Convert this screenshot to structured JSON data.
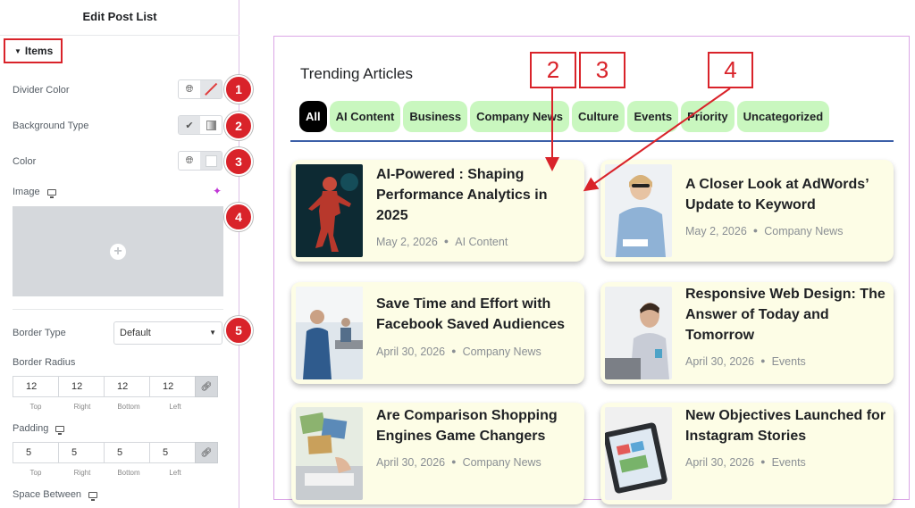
{
  "panel": {
    "title": "Edit Post List",
    "section": "Items",
    "divider_color_label": "Divider Color",
    "background_type_label": "Background Type",
    "color_label": "Color",
    "image_label": "Image",
    "border_type_label": "Border Type",
    "border_type_value": "Default",
    "border_radius_label": "Border Radius",
    "border_radius": [
      "12",
      "12",
      "12",
      "12"
    ],
    "padding_label": "Padding",
    "padding": [
      "5",
      "5",
      "5",
      "5"
    ],
    "dim_labels": [
      "Top",
      "Right",
      "Bottom",
      "Left"
    ],
    "space_between_label": "Space Between"
  },
  "badges": [
    "1",
    "2",
    "3",
    "4",
    "5"
  ],
  "annotations": [
    "2",
    "3",
    "4"
  ],
  "preview": {
    "heading": "Trending Articles",
    "tabs": [
      "All",
      "AI Content",
      "Business",
      "Company News",
      "Culture",
      "Events",
      "Priority",
      "Uncategorized"
    ],
    "cards": [
      {
        "title": "AI-Powered : Shaping Performance Analytics in 2025",
        "date": "May 2, 2026",
        "category": "AI Content"
      },
      {
        "title": "A Closer Look at AdWords’ Update to Keyword",
        "date": "May 2, 2026",
        "category": "Company News"
      },
      {
        "title": "Save Time and Effort with Facebook Saved Audiences",
        "date": "April 30, 2026",
        "category": "Company News"
      },
      {
        "title": "Responsive Web Design: The Answer of Today and Tomorrow",
        "date": "April 30, 2026",
        "category": "Events"
      },
      {
        "title": "Are Comparison Shopping Engines Game Changers",
        "date": "April 30, 2026",
        "category": "Company News"
      },
      {
        "title": "New Objectives Launched for Instagram Stories",
        "date": "April 30, 2026",
        "category": "Events"
      }
    ]
  },
  "colors": {
    "accent_red": "#d9232a",
    "tab_green": "#c9f7bf",
    "card_bg": "#fdfde6",
    "underline_blue": "#3c5fa8"
  }
}
